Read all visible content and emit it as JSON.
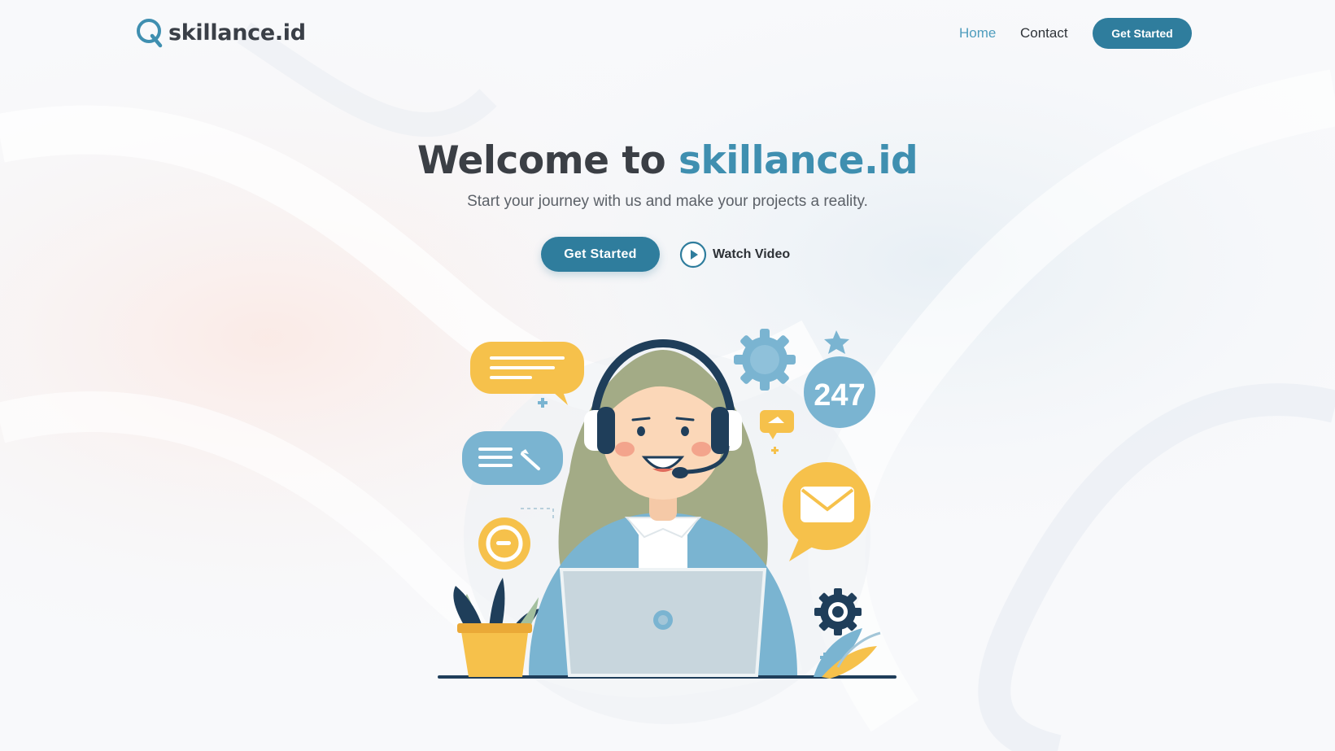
{
  "header": {
    "logo_text": "skillance.id",
    "nav": {
      "home": "Home",
      "contact": "Contact"
    },
    "cta_label": "Get Started"
  },
  "hero": {
    "title_prefix": "Welcome to ",
    "title_accent": "skillance.id",
    "subtitle": "Start your journey with us and make your projects a reality.",
    "primary_cta": "Get Started",
    "video_cta": "Watch Video"
  },
  "illustration": {
    "badge_text": "247"
  },
  "colors": {
    "brand": "#2f7d9d",
    "accent": "#3f8fb0",
    "link_active": "#4f9dbd",
    "yellow": "#f6c14b",
    "illustration_blue": "#7ab4d1"
  }
}
